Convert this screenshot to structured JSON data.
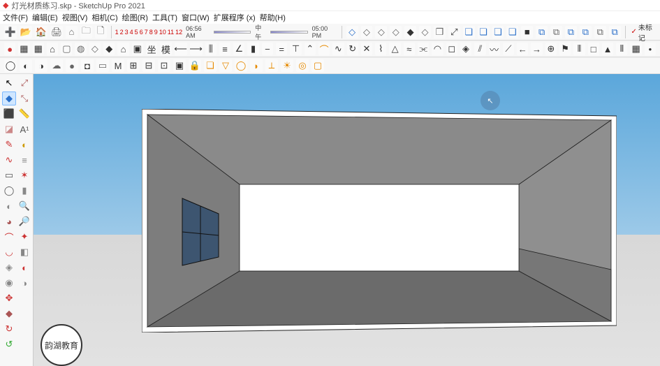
{
  "title": "灯光材质练习.skp - SketchUp Pro 2021",
  "menu": {
    "file": "文件(F)",
    "edit": "编辑(E)",
    "view": "视图(V)",
    "camera": "相机(C)",
    "draw": "绘图(R)",
    "tools": "工具(T)",
    "window": "窗口(W)",
    "extensions": "扩展程序 (x)",
    "help": "帮助(H)"
  },
  "timeline": {
    "nums": [
      "1",
      "2",
      "3",
      "4",
      "5",
      "6",
      "7",
      "8",
      "9",
      "10",
      "11",
      "12"
    ],
    "time_left": "06:56 AM",
    "noon": "中午",
    "time_right": "05:00 PM"
  },
  "untagged": "未标记",
  "toolbar_row1_left": [
    {
      "name": "new-file-icon",
      "glyph": "➕",
      "cls": "gray"
    },
    {
      "name": "open-file-icon",
      "glyph": "📂",
      "cls": "gray"
    },
    {
      "name": "home-icon",
      "glyph": "🏠",
      "cls": "gray"
    },
    {
      "name": "print-icon",
      "glyph": "🖨",
      "cls": "gray"
    },
    {
      "name": "house-icon",
      "glyph": "⌂",
      "cls": "gray"
    },
    {
      "name": "folder-icon",
      "glyph": "🗀",
      "cls": "gray"
    },
    {
      "name": "page-icon",
      "glyph": "🗋",
      "cls": "gray"
    }
  ],
  "toolbar_row1_right": [
    {
      "name": "diamond1-icon",
      "glyph": "◇",
      "cls": "blue"
    },
    {
      "name": "diamond2-icon",
      "glyph": "◇",
      "cls": "gray"
    },
    {
      "name": "diamond3-icon",
      "glyph": "◇",
      "cls": "gray"
    },
    {
      "name": "diamond4-icon",
      "glyph": "◇",
      "cls": "gray"
    },
    {
      "name": "diamond5-icon",
      "glyph": "◆",
      "cls": "dark"
    },
    {
      "name": "diamond6-icon",
      "glyph": "◇",
      "cls": "gray"
    },
    {
      "name": "stack-icon",
      "glyph": "❒",
      "cls": "gray"
    },
    {
      "name": "arrow-diag-icon",
      "glyph": "⤢",
      "cls": "dark"
    },
    {
      "name": "cube1-icon",
      "glyph": "❏",
      "cls": "blue"
    },
    {
      "name": "cube2-icon",
      "glyph": "❏",
      "cls": "blue"
    },
    {
      "name": "cube3-icon",
      "glyph": "❏",
      "cls": "blue"
    },
    {
      "name": "cube4-icon",
      "glyph": "❏",
      "cls": "blue"
    },
    {
      "name": "cube5-icon",
      "glyph": "■",
      "cls": "dark"
    },
    {
      "name": "copy1-icon",
      "glyph": "⧉",
      "cls": "blue"
    },
    {
      "name": "copy2-icon",
      "glyph": "⧉",
      "cls": "gray"
    },
    {
      "name": "copy3-icon",
      "glyph": "⧉",
      "cls": "blue"
    },
    {
      "name": "copy4-icon",
      "glyph": "⧉",
      "cls": "blue"
    },
    {
      "name": "copy5-icon",
      "glyph": "⧉",
      "cls": "gray"
    },
    {
      "name": "copy6-icon",
      "glyph": "⧉",
      "cls": "blue"
    }
  ],
  "toolbar_row2": [
    {
      "name": "red-dot-icon",
      "glyph": "●",
      "cls": "gray",
      "color": "#c33"
    },
    {
      "name": "grid1-icon",
      "glyph": "▦",
      "cls": "dark"
    },
    {
      "name": "grid2-icon",
      "glyph": "▦",
      "cls": "dark"
    },
    {
      "name": "house2-icon",
      "glyph": "⌂",
      "cls": "dark"
    },
    {
      "name": "page2-icon",
      "glyph": "▢",
      "cls": "gray"
    },
    {
      "name": "globe-icon",
      "glyph": "◍",
      "cls": "gray"
    },
    {
      "name": "diamond7-icon",
      "glyph": "◇",
      "cls": "gray"
    },
    {
      "name": "diamond8-icon",
      "glyph": "◆",
      "cls": "dark"
    },
    {
      "name": "house3-icon",
      "glyph": "⌂",
      "cls": "dark"
    },
    {
      "name": "top-icon",
      "glyph": "▣",
      "cls": "dark"
    },
    {
      "name": "kanji1-icon",
      "glyph": "坐",
      "cls": "dark"
    },
    {
      "name": "kanji2-icon",
      "glyph": "模",
      "cls": "dark"
    },
    {
      "name": "arrow-left-icon",
      "glyph": "⟵",
      "cls": "dark"
    },
    {
      "name": "arrow-right-icon",
      "glyph": "⟶",
      "cls": "dark"
    },
    {
      "name": "columns-icon",
      "glyph": "⫼",
      "cls": "dark"
    },
    {
      "name": "lines-icon",
      "glyph": "≡",
      "cls": "dark"
    },
    {
      "name": "angle-icon",
      "glyph": "∠",
      "cls": "dark"
    },
    {
      "name": "bars-icon",
      "glyph": "▮",
      "cls": "dark"
    },
    {
      "name": "minus-icon",
      "glyph": "−",
      "cls": "dark"
    },
    {
      "name": "equal-icon",
      "glyph": "=",
      "cls": "dark"
    },
    {
      "name": "t-icon",
      "glyph": "⊤",
      "cls": "dark"
    },
    {
      "name": "caret-up-icon",
      "glyph": "⌃",
      "cls": "dark"
    },
    {
      "name": "curve1-icon",
      "glyph": "⌒",
      "cls": "orange"
    },
    {
      "name": "curve2-icon",
      "glyph": "∿",
      "cls": "dark"
    },
    {
      "name": "refresh-icon",
      "glyph": "↻",
      "cls": "dark"
    },
    {
      "name": "cross-icon",
      "glyph": "✕",
      "cls": "dark"
    },
    {
      "name": "zigzag-icon",
      "glyph": "⌇",
      "cls": "dark"
    },
    {
      "name": "triangle-icon",
      "glyph": "△",
      "cls": "dark"
    },
    {
      "name": "wave-icon",
      "glyph": "≈",
      "cls": "dark"
    },
    {
      "name": "link-icon",
      "glyph": "⫘",
      "cls": "dark"
    },
    {
      "name": "arc-icon",
      "glyph": "◠",
      "cls": "dark"
    },
    {
      "name": "box-icon",
      "glyph": "◻",
      "cls": "dark"
    },
    {
      "name": "diamond9-icon",
      "glyph": "◈",
      "cls": "dark"
    },
    {
      "name": "slash-icon",
      "glyph": "⫽",
      "cls": "dark"
    },
    {
      "name": "wave2-icon",
      "glyph": "〰",
      "cls": "dark"
    },
    {
      "name": "slash2-icon",
      "glyph": "⟋",
      "cls": "dark"
    },
    {
      "name": "arrow-l2-icon",
      "glyph": "←",
      "cls": "dark"
    },
    {
      "name": "arrow-r2-icon",
      "glyph": "→",
      "cls": "dark"
    },
    {
      "name": "target-icon",
      "glyph": "⊕",
      "cls": "dark"
    },
    {
      "name": "flag-icon",
      "glyph": "⚑",
      "cls": "dark"
    },
    {
      "name": "bars2-icon",
      "glyph": "⦀",
      "cls": "dark"
    },
    {
      "name": "square-icon",
      "glyph": "□",
      "cls": "dark"
    },
    {
      "name": "tri2-icon",
      "glyph": "▲",
      "cls": "dark"
    },
    {
      "name": "bars3-icon",
      "glyph": "⦀",
      "cls": "dark"
    },
    {
      "name": "grid3-icon",
      "glyph": "▦",
      "cls": "dark"
    },
    {
      "name": "dot-icon",
      "glyph": "•",
      "cls": "dark"
    }
  ],
  "toolbar_row3": [
    {
      "name": "circle1-icon",
      "glyph": "◯",
      "cls": "dark"
    },
    {
      "name": "teapot-icon",
      "glyph": "◐",
      "cls": "dark"
    },
    {
      "name": "teapot2-icon",
      "glyph": "◑",
      "cls": "dark"
    },
    {
      "name": "cloud-icon",
      "glyph": "☁",
      "cls": "gray"
    },
    {
      "name": "sphere-icon",
      "glyph": "●",
      "cls": "gray"
    },
    {
      "name": "material-icon",
      "glyph": "◘",
      "cls": "dark"
    },
    {
      "name": "scene-icon",
      "glyph": "▭",
      "cls": "gray"
    },
    {
      "name": "m-icon",
      "glyph": "M",
      "cls": "dark"
    },
    {
      "name": "window1-icon",
      "glyph": "⊞",
      "cls": "dark"
    },
    {
      "name": "window2-icon",
      "glyph": "⊟",
      "cls": "dark"
    },
    {
      "name": "window3-icon",
      "glyph": "⊡",
      "cls": "dark"
    },
    {
      "name": "window4-icon",
      "glyph": "▣",
      "cls": "dark"
    },
    {
      "name": "lock-icon",
      "glyph": "🔒",
      "cls": "gray"
    },
    {
      "name": "layers-icon",
      "glyph": "❏",
      "cls": "orange"
    },
    {
      "name": "shape1-icon",
      "glyph": "▽",
      "cls": "orange"
    },
    {
      "name": "shape2-icon",
      "glyph": "◯",
      "cls": "orange"
    },
    {
      "name": "shape3-icon",
      "glyph": "◗",
      "cls": "orange"
    },
    {
      "name": "shape4-icon",
      "glyph": "⟂",
      "cls": "orange"
    },
    {
      "name": "sun-icon",
      "glyph": "☀",
      "cls": "orange"
    },
    {
      "name": "ring-icon",
      "glyph": "◎",
      "cls": "orange"
    },
    {
      "name": "box2-icon",
      "glyph": "▢",
      "cls": "orange"
    }
  ],
  "left_tools": [
    {
      "name": "select-tool-icon",
      "glyph": "↖",
      "color": "#000",
      "active": false
    },
    {
      "name": "select-alt-icon",
      "glyph": "◆",
      "color": "#2a6fc9",
      "active": true
    },
    {
      "name": "eraser-tool-icon",
      "glyph": "⬛",
      "color": "#c44",
      "active": false
    },
    {
      "name": "eraser2-icon",
      "glyph": "◪",
      "color": "#c88",
      "active": false
    },
    {
      "name": "line-tool-icon",
      "glyph": "✎",
      "color": "#c33",
      "active": false
    },
    {
      "name": "freehand-icon",
      "glyph": "∿",
      "color": "#c33",
      "active": false
    },
    {
      "name": "rect-tool-icon",
      "glyph": "▭",
      "color": "#555",
      "active": false
    },
    {
      "name": "circle-tool-icon",
      "glyph": "◯",
      "color": "#555",
      "active": false
    },
    {
      "name": "polygon-icon",
      "glyph": "◐",
      "color": "#888",
      "active": false
    },
    {
      "name": "pie-icon",
      "glyph": "◕",
      "color": "#a55",
      "active": false
    },
    {
      "name": "arc-tool-icon",
      "glyph": "⌒",
      "color": "#c33",
      "active": false
    },
    {
      "name": "arc2-icon",
      "glyph": "◡",
      "color": "#c33",
      "active": false
    },
    {
      "name": "pushpull-icon",
      "glyph": "◈",
      "color": "#888",
      "active": false
    },
    {
      "name": "offset-icon",
      "glyph": "◉",
      "color": "#888",
      "active": false
    },
    {
      "name": "move-tool-icon",
      "glyph": "✥",
      "color": "#c33",
      "active": false
    },
    {
      "name": "followme-icon",
      "glyph": "◆",
      "color": "#a55",
      "active": false
    },
    {
      "name": "rotate-tool-icon",
      "glyph": "↻",
      "color": "#c33",
      "active": false
    },
    {
      "name": "rotate2-icon",
      "glyph": "↺",
      "color": "#3a3",
      "active": false
    },
    {
      "name": "scale-tool-icon",
      "glyph": "⤢",
      "color": "#a55",
      "active": false
    },
    {
      "name": "scale2-icon",
      "glyph": "⤡",
      "color": "#a55",
      "active": false
    },
    {
      "name": "tape-tool-icon",
      "glyph": "📏",
      "color": "#888",
      "active": false
    },
    {
      "name": "text-tool-icon",
      "glyph": "A¹",
      "color": "#555",
      "active": false
    },
    {
      "name": "protractor-icon",
      "glyph": "◐",
      "color": "#c90",
      "active": false
    },
    {
      "name": "dims-icon",
      "glyph": "≡",
      "color": "#888",
      "active": false
    },
    {
      "name": "axes-tool-icon",
      "glyph": "✶",
      "color": "#c33",
      "active": false
    },
    {
      "name": "paint-tool-icon",
      "glyph": "▮",
      "color": "#888",
      "active": false
    },
    {
      "name": "orbit-tool-icon",
      "glyph": "🔍",
      "color": "#555",
      "active": false
    },
    {
      "name": "zoom-tool-icon",
      "glyph": "🔎",
      "color": "#555",
      "active": false
    },
    {
      "name": "pan-tool-icon",
      "glyph": "✦",
      "color": "#c33",
      "active": false
    },
    {
      "name": "section-icon",
      "glyph": "◧",
      "color": "#888",
      "active": false
    },
    {
      "name": "walk-tool-icon",
      "glyph": "◐",
      "color": "#c33",
      "active": false
    },
    {
      "name": "look-tool-icon",
      "glyph": "◑",
      "color": "#888",
      "active": false
    }
  ],
  "watermark": "韵湖教育",
  "cursor_glyph": "↖"
}
